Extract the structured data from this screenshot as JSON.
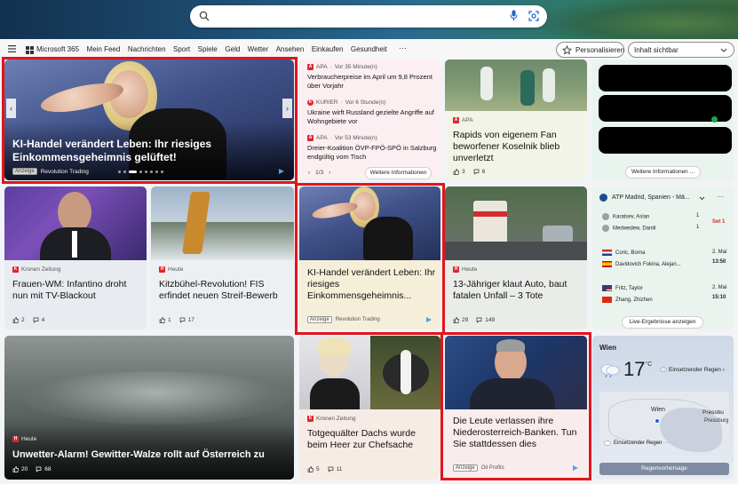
{
  "nav": {
    "brand": "Microsoft 365",
    "links": [
      "Mein Feed",
      "Nachrichten",
      "Sport",
      "Spiele",
      "Geld",
      "Wetter",
      "Ansehen",
      "Einkaufen",
      "Gesundheit"
    ],
    "more": "···",
    "personalize": "Personalisieren",
    "visibility": "Inhalt sichtbar"
  },
  "hero_ad": {
    "headline": "KI-Handel verändert Leben: Ihr riesiges Einkommensgeheimnis gelüftet!",
    "tag": "Anzeige",
    "source": "Revolution Trading"
  },
  "news_list": {
    "items": [
      {
        "source": "APA",
        "time": "Vor 35 Minute(n)",
        "headline": "Verbraucherpreise im April um 9,8 Prozent über Vorjahr"
      },
      {
        "source": "KURIER",
        "time": "Vor 6 Stunde(n)",
        "headline": "Ukraine wirft Russland gezielte Angriffe auf Wohngebiete vor"
      },
      {
        "source": "APA",
        "time": "Vor 53 Minute(n)",
        "headline": "Dreier-Koalition ÖVP-FPÖ-SPÖ in Salzburg endgültig vom Tisch"
      }
    ],
    "pager": "1/3",
    "more": "Weitere Informationen"
  },
  "rapid": {
    "source": "APA",
    "headline": "Rapids von eigenem Fan beworfener Koselnik blieb unverletzt",
    "likes": "3",
    "comments": "6"
  },
  "redacted": {
    "more": "Weitere Informationen ..."
  },
  "infantino": {
    "source": "Kronen Zeitung",
    "headline": "Frauen-WM: Infantino droht nun mit TV-Blackout",
    "likes": "2",
    "comments": "4"
  },
  "kitz": {
    "source": "Heute",
    "headline": "Kitzbühel-Revolution! FIS erfindet neuen Streif-Bewerb",
    "likes": "1",
    "comments": "17"
  },
  "ad2": {
    "headline": "KI-Handel verändert Leben: Ihr riesiges Einkommensgeheimnis...",
    "tag": "Anzeige",
    "source": "Revolution Trading"
  },
  "auto": {
    "source": "Heute",
    "headline": "13-Jähriger klaut Auto, baut fatalen Unfall – 3 Tote",
    "likes": "29",
    "comments": "149"
  },
  "sports": {
    "title": "ATP Madrid, Spanien - Mä...",
    "matches": [
      {
        "p1": "Karatsev, Aslan",
        "p2": "Medwedew, Daniil",
        "status": "Set 1",
        "p1_score": "1",
        "p2_score": "1"
      },
      {
        "p1": "Coric, Borna",
        "p2": "Davidovich Fokina, Alejan...",
        "date": "2. Mai",
        "time": "13:50"
      },
      {
        "p1": "Fritz, Taylor",
        "p2": "Zhang, Zhizhen",
        "date": "2. Mai",
        "time": "15:10"
      }
    ],
    "live": "Live-Ergebnisse anzeigen"
  },
  "storm": {
    "source": "Heute",
    "headline": "Unwetter-Alarm! Gewitter-Walze rollt auf Österreich zu",
    "likes": "20",
    "comments": "68"
  },
  "dachs": {
    "source": "Kronen Zeitung",
    "headline": "Totgequälter Dachs wurde beim Heer zur Chefsache",
    "likes": "5",
    "comments": "11"
  },
  "bank_ad": {
    "headline": "Die Leute verlassen ihre Niederosterreich-Banken. Tun Sie stattdessen dies",
    "tag": "Anzeige",
    "source": "Oil Profits"
  },
  "weather": {
    "city": "Wien",
    "temp": "17",
    "unit": "°C",
    "condition": "Einsetzender Regen",
    "map_label1": "Wien",
    "map_label2": "Pressbu",
    "map_label3": "Pressburg",
    "map_rain": "Einsetzender Regen",
    "button": "Regenvorhersage"
  }
}
